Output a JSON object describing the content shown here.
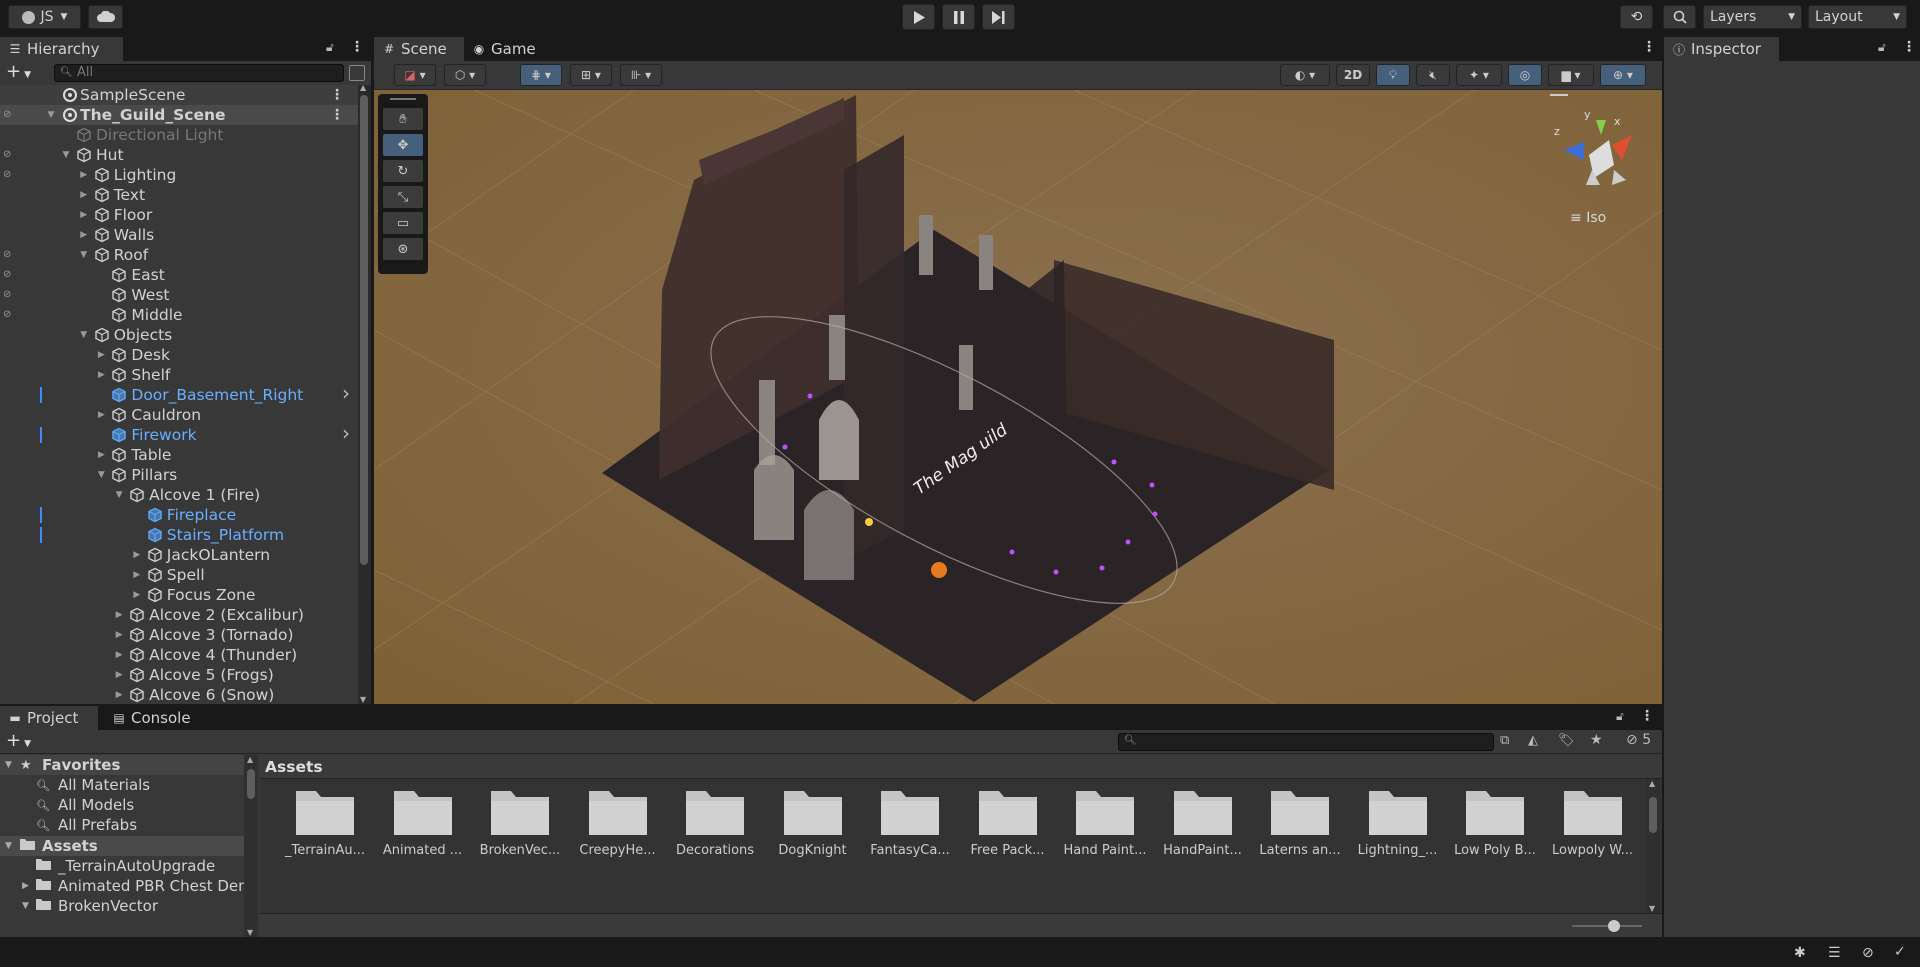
{
  "topbar": {
    "account_label": "JS",
    "layers_label": "Layers",
    "layout_label": "Layout"
  },
  "hierarchy": {
    "tab_label": "Hierarchy",
    "search_placeholder": "All",
    "items": [
      {
        "label": "SampleScene",
        "kind": "scene"
      },
      {
        "label": "The_Guild_Scene",
        "kind": "scene"
      },
      {
        "label": "Directional Light",
        "kind": "disabled"
      },
      {
        "label": "Hut"
      },
      {
        "label": "Lighting"
      },
      {
        "label": "Text"
      },
      {
        "label": "Floor"
      },
      {
        "label": "Walls"
      },
      {
        "label": "Roof"
      },
      {
        "label": "East"
      },
      {
        "label": "West"
      },
      {
        "label": "Middle"
      },
      {
        "label": "Objects"
      },
      {
        "label": "Desk"
      },
      {
        "label": "Shelf"
      },
      {
        "label": "Door_Basement_Right",
        "kind": "prefab"
      },
      {
        "label": "Cauldron"
      },
      {
        "label": "Firework",
        "kind": "prefab"
      },
      {
        "label": "Table"
      },
      {
        "label": "Pillars"
      },
      {
        "label": "Alcove 1 (Fire)"
      },
      {
        "label": "Fireplace",
        "kind": "prefab"
      },
      {
        "label": "Stairs_Platform",
        "kind": "prefab"
      },
      {
        "label": "JackOLantern"
      },
      {
        "label": "Spell"
      },
      {
        "label": "Focus Zone"
      },
      {
        "label": "Alcove 2 (Excalibur)"
      },
      {
        "label": "Alcove 3 (Tornado)"
      },
      {
        "label": "Alcove 4 (Thunder)"
      },
      {
        "label": "Alcove 5 (Frogs)"
      },
      {
        "label": "Alcove 6 (Snow)"
      }
    ]
  },
  "scene": {
    "tab_scene": "Scene",
    "tab_game": "Game",
    "toggle_2d": "2D",
    "projection_label": "Iso",
    "gizmo_x": "x",
    "gizmo_y": "y",
    "gizmo_z": "z",
    "sign_text": "The Mag  uild"
  },
  "inspector": {
    "tab_label": "Inspector"
  },
  "project": {
    "tab_project": "Project",
    "tab_console": "Console",
    "hidden_count": "5",
    "breadcrumb": "Assets",
    "tree": [
      {
        "label": "Favorites",
        "kind": "header"
      },
      {
        "label": "All Materials"
      },
      {
        "label": "All Models"
      },
      {
        "label": "All Prefabs"
      },
      {
        "label": "Assets",
        "kind": "header"
      },
      {
        "label": "_TerrainAutoUpgrade"
      },
      {
        "label": "Animated PBR Chest Dem"
      },
      {
        "label": "BrokenVector"
      }
    ],
    "assets": [
      "_TerrainAu...",
      "Animated ...",
      "BrokenVec...",
      "CreepyHe...",
      "Decorations",
      "DogKnight",
      "FantasyCa...",
      "Free Pack...",
      "Hand Paint...",
      "HandPaint...",
      "Laterns an...",
      "Lightning_...",
      "Low Poly B...",
      "Lowpoly W..."
    ]
  }
}
